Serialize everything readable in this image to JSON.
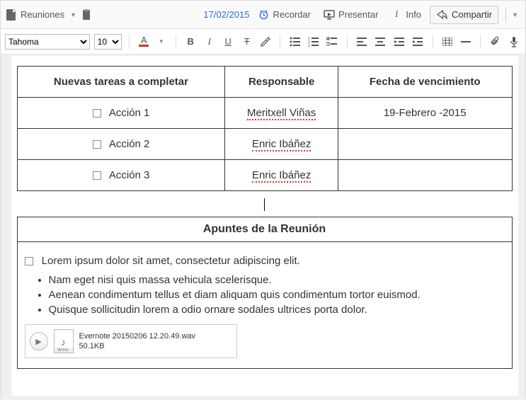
{
  "header": {
    "notebook_label": "Reuniones",
    "date": "17/02/2015",
    "reminder_label": "Recordar",
    "present_label": "Presentar",
    "info_label": "Info",
    "share_label": "Compartir"
  },
  "toolbar": {
    "font_name": "Tahoma",
    "font_size": "10",
    "icons": {
      "textcolor": "A",
      "bold": "B",
      "italic": "I",
      "underline": "U",
      "strike": "T"
    }
  },
  "tasks_table": {
    "headers": [
      "Nuevas tareas a completar",
      "Responsable",
      "Fecha de vencimiento"
    ],
    "rows": [
      {
        "action": "Acción 1",
        "owner": "Meritxell Viñas",
        "due": "19-Febrero -2015",
        "owner_spell": true
      },
      {
        "action": "Acción 2",
        "owner": "Enric Ibáñez",
        "due": "",
        "owner_spell": true
      },
      {
        "action": "Acción 3",
        "owner": "Enric Ibáñez",
        "due": "",
        "owner_spell": true
      }
    ]
  },
  "notes": {
    "title": "Apuntes de la Reunión",
    "lead": "Lorem ipsum dolor sit amet, consectetur adipiscing elit.",
    "bullets": [
      "Nam eget nisi quis massa vehicula scelerisque.",
      "Aenean condimentum tellus et diam aliquam quis condimentum tortor euismod.",
      "Quisque sollicitudin lorem a odio ornare sodales ultrices porta dolor."
    ]
  },
  "attachment": {
    "filename": "Evernote 20150206 12.20.49.wav",
    "size": "50.1KB"
  }
}
